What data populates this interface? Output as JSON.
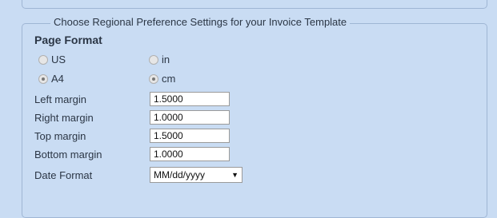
{
  "legend": "Choose Regional Preference Settings for your Invoice Template",
  "page_format": {
    "title": "Page Format",
    "options": [
      {
        "label": "US",
        "checked": false
      },
      {
        "label": "in",
        "checked": false
      },
      {
        "label": "A4",
        "checked": true
      },
      {
        "label": "cm",
        "checked": true
      }
    ]
  },
  "margins": {
    "left_label": "Left margin",
    "left_value": "1.5000",
    "right_label": "Right margin",
    "right_value": "1.0000",
    "top_label": "Top margin",
    "top_value": "1.5000",
    "bottom_label": "Bottom margin",
    "bottom_value": "1.0000"
  },
  "date_format": {
    "label": "Date Format",
    "value": "MM/dd/yyyy",
    "arrow": "▼"
  }
}
